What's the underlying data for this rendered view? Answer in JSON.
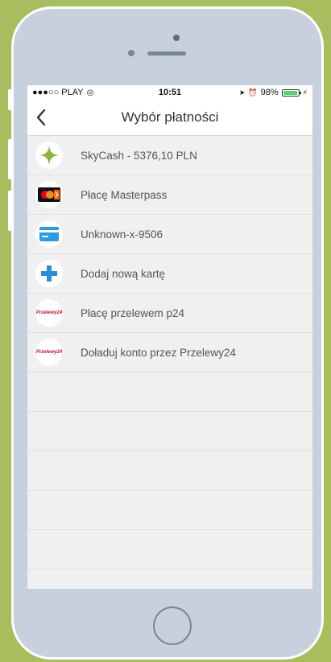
{
  "status_bar": {
    "carrier": "●●●○○ PLAY",
    "time": "10:51",
    "battery": "98%",
    "battery_level": 0.98
  },
  "nav": {
    "title": "Wybór płatności",
    "back_icon": "chevron-left-icon"
  },
  "payment_methods": [
    {
      "label": "SkyCash - 5376,10 PLN",
      "icon": "skycash-star-icon"
    },
    {
      "label": "Płacę Masterpass",
      "icon": "masterpass-icon"
    },
    {
      "label": "Unknown-x-9506",
      "icon": "credit-card-icon"
    },
    {
      "label": "Dodaj nową kartę",
      "icon": "plus-icon"
    },
    {
      "label": "Płacę przelewem p24",
      "icon": "przelewy24-icon"
    },
    {
      "label": "Doładuj konto przez Przelewy24",
      "icon": "przelewy24-icon"
    }
  ],
  "brand": {
    "p24_logo_text": "Przelewy24"
  },
  "colors": {
    "background": "#a7bd5e",
    "skycash_green": "#8ab33c",
    "card_blue": "#2a9be0",
    "plus_blue": "#2a8fd6",
    "p24_red": "#c4122f"
  }
}
